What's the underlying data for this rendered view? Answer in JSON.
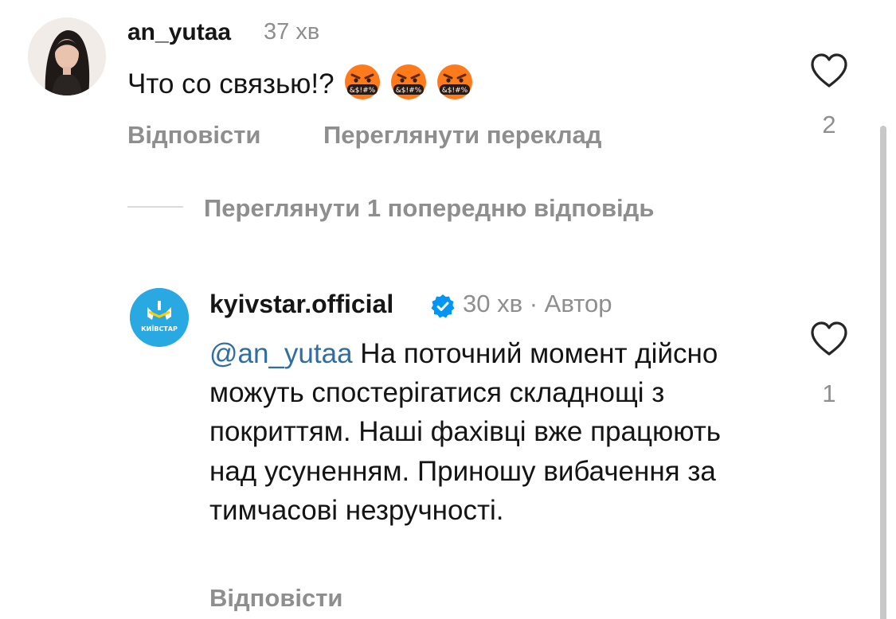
{
  "comment": {
    "username": "an_yutaa",
    "time": "37 хв",
    "text": "Что со связью!?",
    "emoji": [
      "angry-face-with-symbols",
      "angry-face-with-symbols",
      "angry-face-with-symbols"
    ],
    "emoji_text": "&$!#%",
    "reply_label": "Відповісти",
    "translate_label": "Переглянути переклад",
    "likes": "2"
  },
  "view_replies_label": "Переглянути 1 попередню відповідь",
  "reply": {
    "username": "kyivstar.official",
    "avatar_text": "КИЇВСТАР",
    "verified_icon": "verified-badge-icon",
    "time": "30 хв",
    "separator": "·",
    "author_label": "Автор",
    "mention": "@an_yutaa",
    "text": " На поточний момент дійсно можуть спостерігатися складнощі з покриттям. Наші фахівці вже працюють над усуненням. Приношу вибачення за тимчасові незручності.",
    "reply_label": "Відповісти",
    "likes": "1"
  },
  "colors": {
    "muted": "#8e8e8e",
    "mention": "#2f6ea3",
    "verified": "#0095f6",
    "brand": "#29a9e1",
    "emoji_face": "#ff7a1a"
  }
}
